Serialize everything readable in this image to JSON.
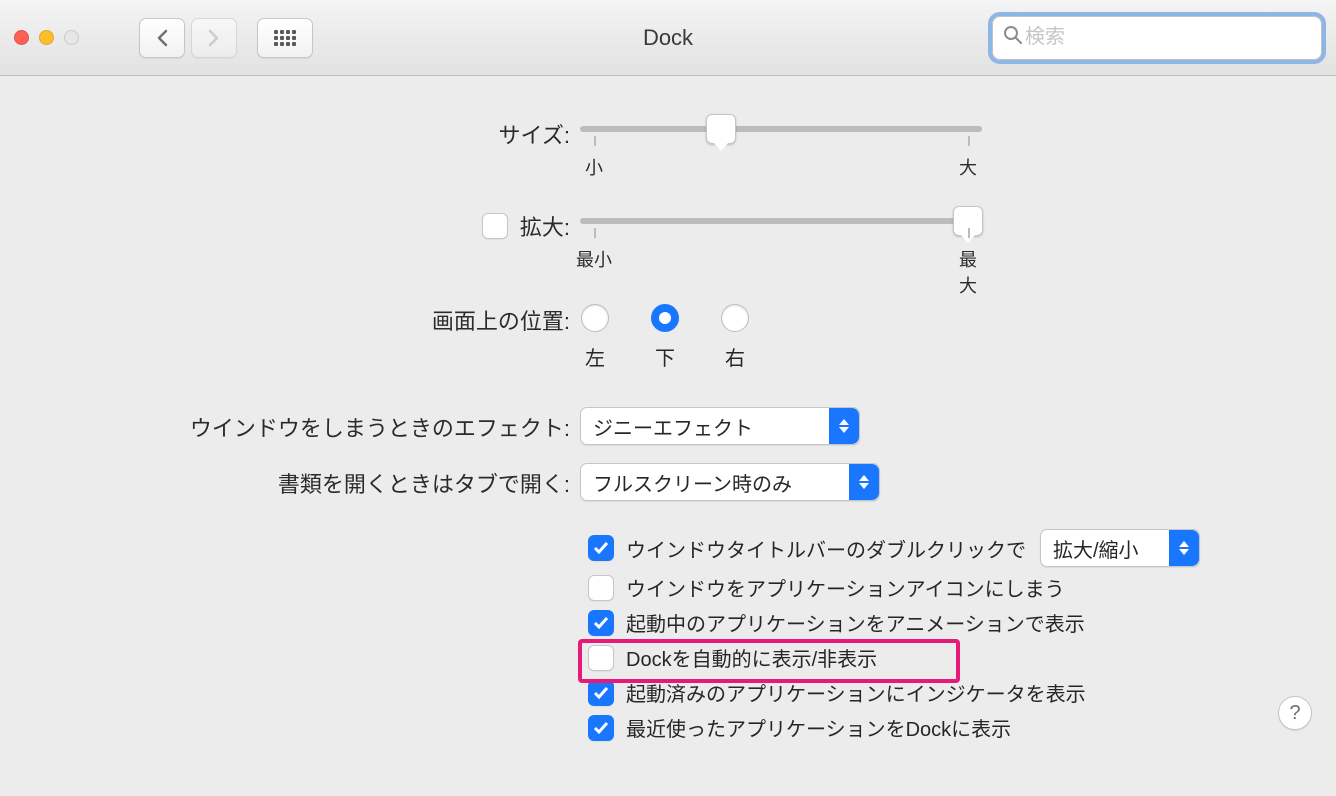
{
  "header": {
    "title": "Dock",
    "search_placeholder": "検索"
  },
  "size": {
    "label": "サイズ:",
    "min_tick": "小",
    "max_tick": "大",
    "value_pct": 34
  },
  "magnify": {
    "label": "拡大:",
    "checked": false,
    "min_tick": "最小",
    "max_tick": "最大",
    "value_pct": 100
  },
  "position": {
    "label": "画面上の位置:",
    "options": [
      "左",
      "下",
      "右"
    ],
    "selected_index": 1
  },
  "effect": {
    "label": "ウインドウをしまうときのエフェクト:",
    "value": "ジニーエフェクト"
  },
  "tabs": {
    "label": "書類を開くときはタブで開く:",
    "value": "フルスクリーン時のみ"
  },
  "checks": {
    "dblclick": {
      "checked": true,
      "text": "ウインドウタイトルバーのダブルクリックで",
      "dropdown": "拡大/縮小"
    },
    "minimize_into_icon": {
      "checked": false,
      "text": "ウインドウをアプリケーションアイコンにしまう"
    },
    "animate_opening": {
      "checked": true,
      "text": "起動中のアプリケーションをアニメーションで表示"
    },
    "autohide": {
      "checked": false,
      "text": "Dockを自動的に表示/非表示"
    },
    "indicators": {
      "checked": true,
      "text": "起動済みのアプリケーションにインジケータを表示"
    },
    "recent_apps": {
      "checked": true,
      "text": "最近使ったアプリケーションをDockに表示"
    }
  },
  "help_label": "?"
}
